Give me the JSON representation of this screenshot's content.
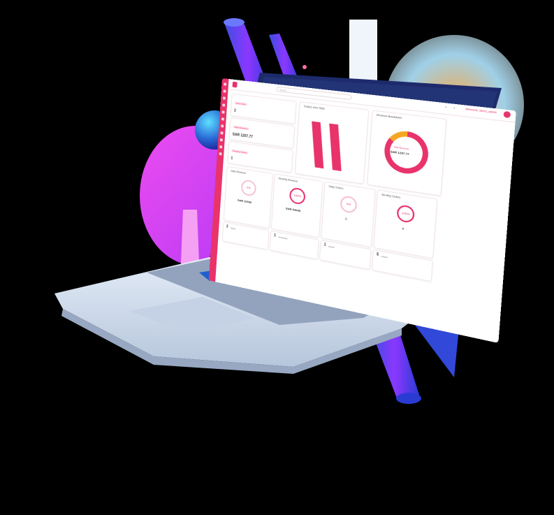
{
  "topbar": {
    "search_placeholder": "Search",
    "welcome": "Welcome, demo_admin",
    "cart_badge": "0"
  },
  "sidebar": {
    "items": [
      "home",
      "orders",
      "products",
      "customers",
      "reports",
      "payments",
      "coupons",
      "reviews",
      "settings",
      "users",
      "logout"
    ]
  },
  "stats": [
    {
      "label": "New Users",
      "value": "2",
      "icon": "user-icon"
    },
    {
      "label": "Daily Revenue",
      "value": "SAR 1207.77",
      "icon": "money-icon"
    },
    {
      "label": "Pending Orders",
      "value": "1",
      "icon": "cart-icon"
    }
  ],
  "chart1": {
    "title": "Today's User Stats"
  },
  "chart2": {
    "title": "Revenue Breakdown",
    "center_label": "Total Revenue",
    "center_value": "SAR 1207.77"
  },
  "chart_data": {
    "type": "pie",
    "values": [
      85,
      15
    ],
    "colors": [
      "#e8336b",
      "#f5a623"
    ]
  },
  "daily_revenue": {
    "title": "Daily Revenue",
    "percent": "0%",
    "value": "SAR 10936"
  },
  "monthly_revenue": {
    "title": "Monthly Revenue",
    "percent": "100%",
    "value": "SAR 54648"
  },
  "daily_orders": {
    "title": "Daily Orders",
    "percent": "0%",
    "value": "1"
  },
  "monthly_orders": {
    "title": "Monthly Orders",
    "percent": "100%",
    "value": "2"
  },
  "bottom_counts": [
    {
      "count": "2",
      "label": "Today"
    },
    {
      "count": "1",
      "label": "Yesterday"
    },
    {
      "count": "1",
      "label": "orders"
    },
    {
      "count": "5",
      "label": "orders"
    }
  ]
}
